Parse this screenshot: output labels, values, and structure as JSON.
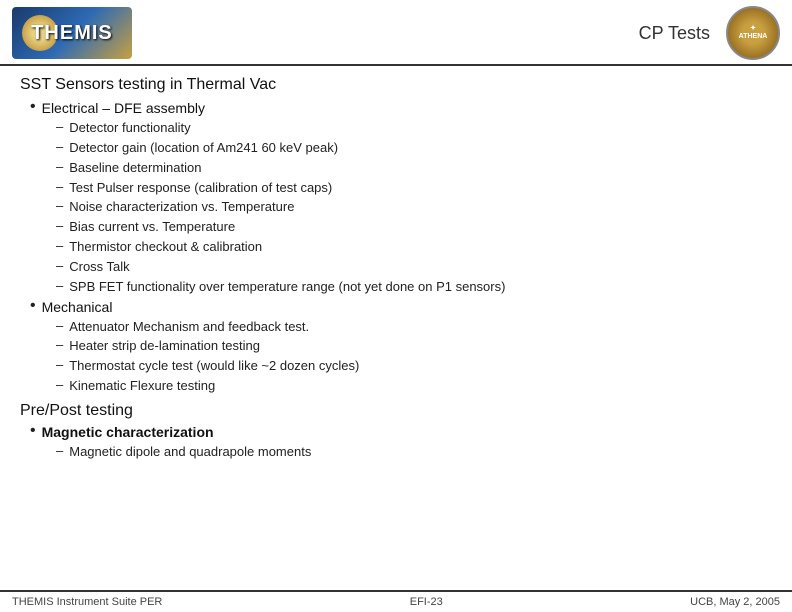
{
  "header": {
    "title": "CP Tests",
    "logo_text": "THEMIS",
    "badge_text": "ATHENA"
  },
  "section1": {
    "title": "SST Sensors testing in Thermal Vac",
    "bullet1": {
      "label": "Electrical – DFE assembly",
      "sub_items": [
        "Detector functionality",
        "Detector gain (location of Am241 60 keV peak)",
        "Baseline determination",
        "Test Pulser response (calibration of test caps)",
        "Noise characterization vs. Temperature",
        "Bias current vs. Temperature",
        "Thermistor checkout & calibration",
        "Cross Talk",
        "SPB FET functionality over temperature range (not yet done on P1 sensors)"
      ]
    },
    "bullet2": {
      "label": "Mechanical",
      "sub_items": [
        "Attenuator Mechanism and feedback test.",
        "Heater strip de-lamination testing",
        "Thermostat cycle test (would like ~2 dozen cycles)",
        "Kinematic Flexure testing"
      ]
    }
  },
  "section2": {
    "title": "Pre/Post testing",
    "bullet1": {
      "label": "Magnetic characterization",
      "sub_items": [
        "Magnetic dipole and quadrapole moments"
      ]
    }
  },
  "footer": {
    "left": "THEMIS Instrument Suite PER",
    "center": "EFI-23",
    "right": "UCB, May 2, 2005"
  }
}
